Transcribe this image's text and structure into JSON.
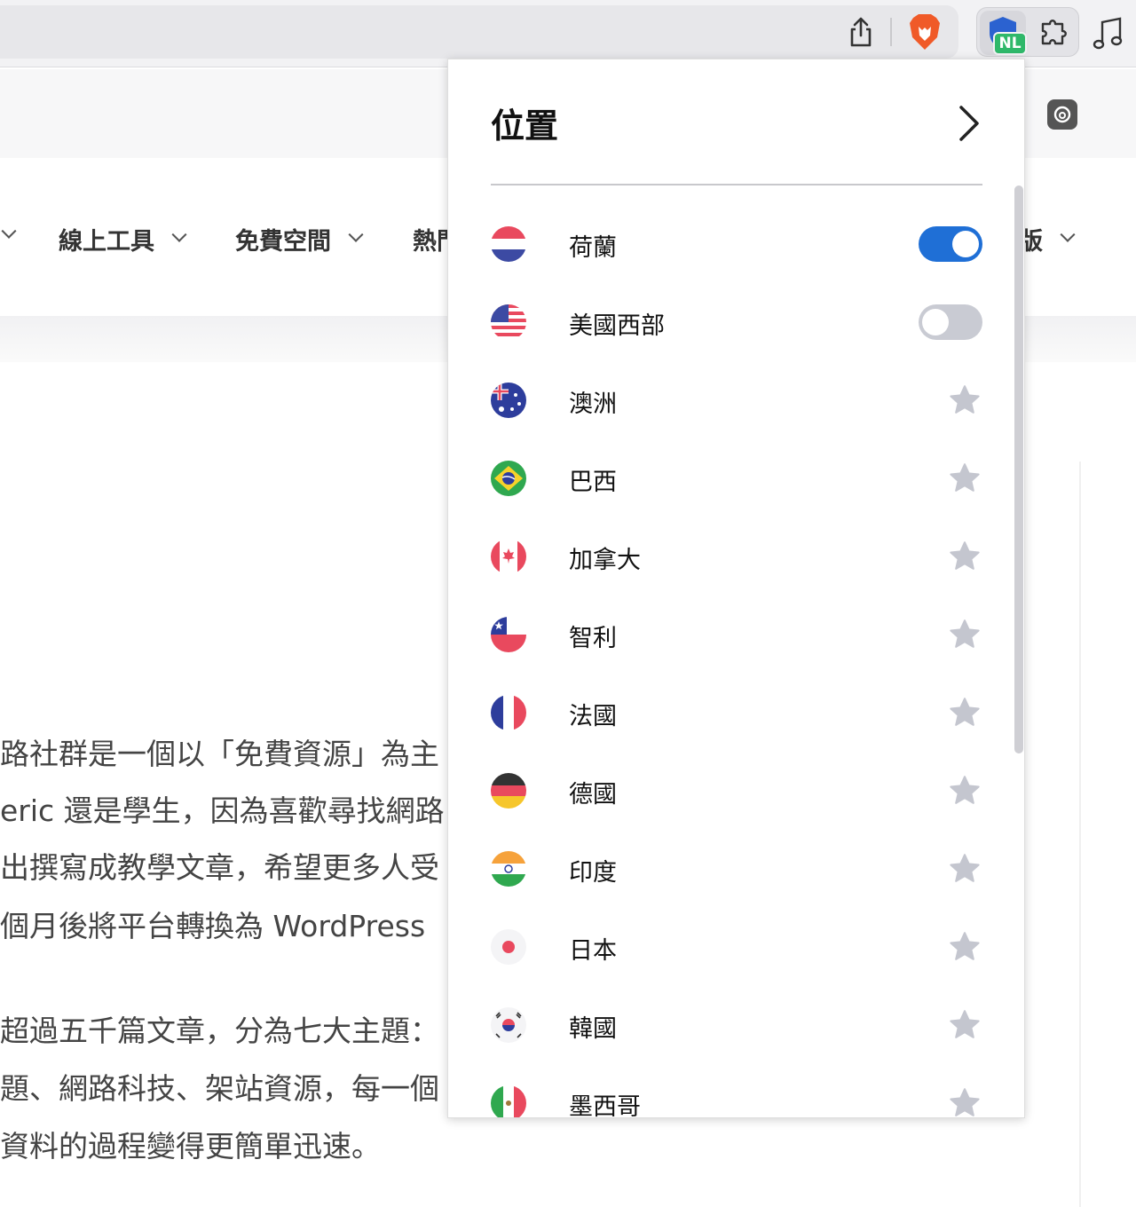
{
  "toolbar": {
    "vpn_badge": "NL",
    "icons": [
      "share-icon",
      "brave-lion-icon",
      "vpn-shield-icon",
      "puzzle-icon",
      "music-note-icon"
    ]
  },
  "page": {
    "nav": [
      {
        "label": "線上工具"
      },
      {
        "label": "免費空間"
      },
      {
        "label": "熱門"
      },
      {
        "label": "版"
      }
    ],
    "paragraph": [
      "路社群是一個以「免費資源」為主",
      "eric 還是學生，因為喜歡尋找網路",
      "出撰寫成教學文章，希望更多人受",
      "個月後將平台轉換為 WordPress",
      "超過五千篇文章，分為七大主題：",
      "題、網路科技、架站資源，每一個",
      "資料的過程變得更簡單迅速。"
    ]
  },
  "popup": {
    "title": "位置",
    "locations": [
      {
        "label": "荷蘭",
        "flag": "netherlands-flag-icon",
        "control": "toggle",
        "on": true
      },
      {
        "label": "美國西部",
        "flag": "usa-flag-icon",
        "control": "toggle",
        "on": false
      },
      {
        "label": "澳洲",
        "flag": "australia-flag-icon",
        "control": "star"
      },
      {
        "label": "巴西",
        "flag": "brazil-flag-icon",
        "control": "star"
      },
      {
        "label": "加拿大",
        "flag": "canada-flag-icon",
        "control": "star"
      },
      {
        "label": "智利",
        "flag": "chile-flag-icon",
        "control": "star"
      },
      {
        "label": "法國",
        "flag": "france-flag-icon",
        "control": "star"
      },
      {
        "label": "德國",
        "flag": "germany-flag-icon",
        "control": "star"
      },
      {
        "label": "印度",
        "flag": "india-flag-icon",
        "control": "star"
      },
      {
        "label": "日本",
        "flag": "japan-flag-icon",
        "control": "star"
      },
      {
        "label": "韓國",
        "flag": "korea-flag-icon",
        "control": "star"
      },
      {
        "label": "墨西哥",
        "flag": "mexico-flag-icon",
        "control": "star"
      }
    ]
  },
  "colors": {
    "toggle_on": "#1f6fd6",
    "toggle_off": "#c9cbd3",
    "star": "#c4c6cf",
    "vpn_badge": "#2fb86a"
  }
}
